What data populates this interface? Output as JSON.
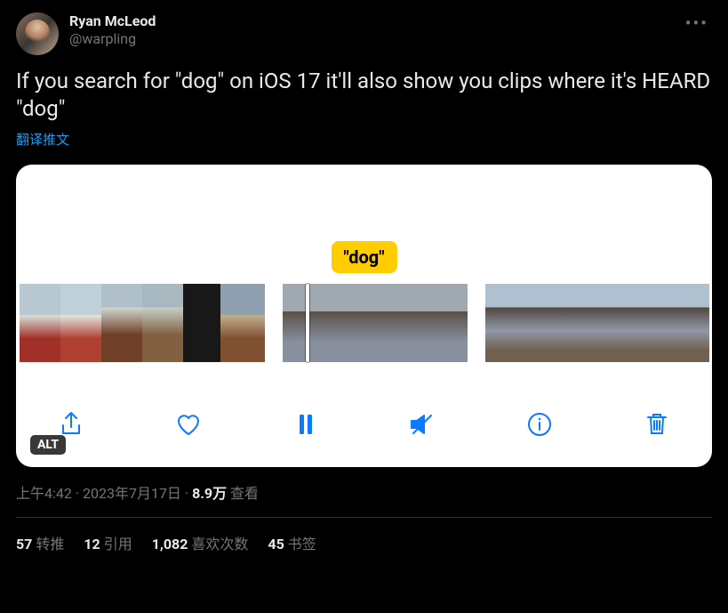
{
  "author": {
    "display_name": "Ryan McLeod",
    "handle": "@warpling"
  },
  "body_text": "If you search for \"dog\" on iOS 17 it'll also show you clips where it's HEARD \"dog\"",
  "translate_label": "翻译推文",
  "media": {
    "dog_tag": "\"dog\"",
    "alt_badge": "ALT"
  },
  "timestamp": {
    "time": "上午4:42",
    "date": "2023年7月17日",
    "views_count": "8.9万",
    "views_label": "查看"
  },
  "stats": {
    "retweets_count": "57",
    "retweets_label": "转推",
    "quotes_count": "12",
    "quotes_label": "引用",
    "likes_count": "1,082",
    "likes_label": "喜欢次数",
    "bookmarks_count": "45",
    "bookmarks_label": "书签"
  }
}
